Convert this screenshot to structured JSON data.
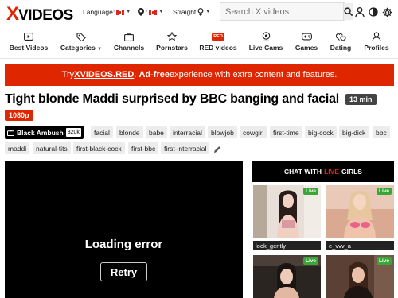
{
  "header": {
    "logo_x": "X",
    "logo_rest": "VIDEOS",
    "language_label": "Language:",
    "country_label": ":",
    "orientation_label": "Straight",
    "search_placeholder": "Search X videos"
  },
  "nav": {
    "items": [
      {
        "label": "Best Videos",
        "icon": "play-icon"
      },
      {
        "label": "Categories",
        "icon": "tags-icon"
      },
      {
        "label": "Channels",
        "icon": "tv-icon"
      },
      {
        "label": "Pornstars",
        "icon": "star-icon"
      },
      {
        "label": "RED videos",
        "icon": "red-badge-icon",
        "badge": "RED"
      },
      {
        "label": "Live Cams",
        "icon": "webcam-icon"
      },
      {
        "label": "Games",
        "icon": "gamepad-icon"
      },
      {
        "label": "Dating",
        "icon": "hearts-icon"
      },
      {
        "label": "Profiles",
        "icon": "user-icon"
      }
    ]
  },
  "promo": {
    "pre": "Try ",
    "link": "XVIDEOS.RED",
    "mid": ". ",
    "bold": "Ad-free",
    "post": " experience with extra content and features."
  },
  "video": {
    "title": "Tight blonde Maddi surprised by BBC banging and facial",
    "duration": "13 min",
    "quality": "1080p",
    "uploader": "Black Ambush",
    "uploader_count": "320k",
    "tags": [
      "facial",
      "blonde",
      "babe",
      "interracial",
      "blowjob",
      "cowgirl",
      "first-time",
      "big-cock",
      "big-dick",
      "bbc",
      "maddi",
      "natural-tits",
      "first-black-cock",
      "first-bbc",
      "first-interracial"
    ]
  },
  "player": {
    "error_text": "Loading error",
    "retry_label": "Retry"
  },
  "live": {
    "header_pre": "CHAT WITH",
    "header_live": "LIVE",
    "header_post": "GIRLS",
    "badge": "Live",
    "cams": [
      {
        "name": "look_gently"
      },
      {
        "name": "e_vvv_a"
      },
      {
        "name": ""
      },
      {
        "name": ""
      }
    ]
  },
  "colors": {
    "brand_red": "#de2600",
    "live_green": "#3aa63a"
  }
}
